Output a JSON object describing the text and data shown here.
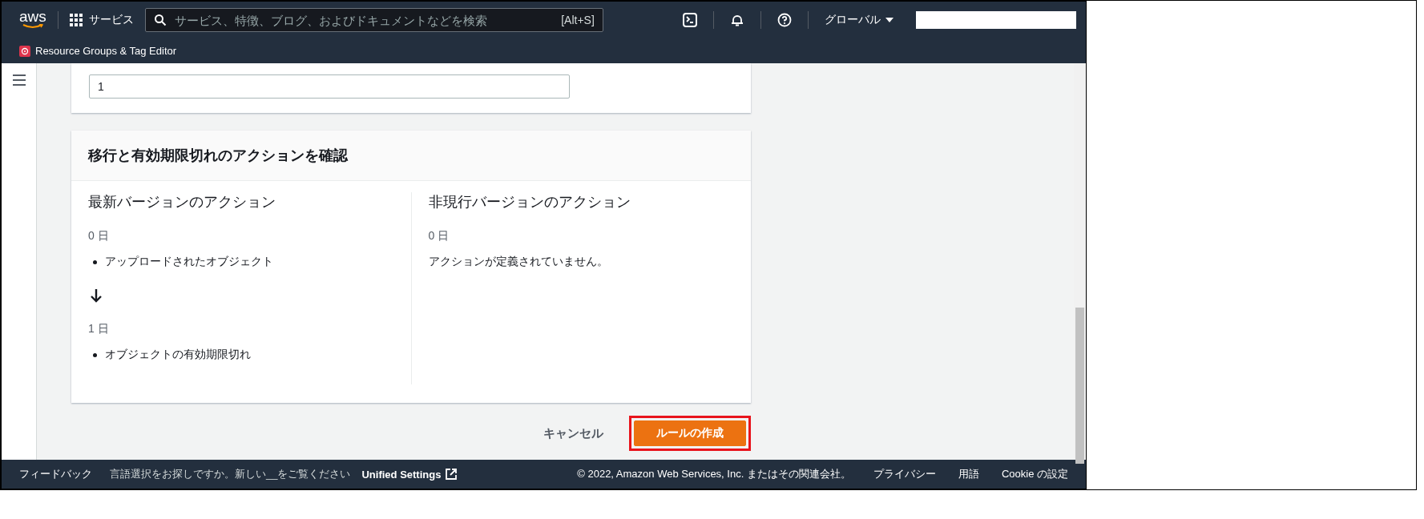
{
  "top_bar": {
    "logo": "aws",
    "services": "サービス",
    "search": {
      "placeholder": "サービス、特徴、ブログ、およびドキュメントなどを検索",
      "shortcut": "[Alt+S]"
    },
    "region": "グローバル"
  },
  "service_bar": {
    "label": "Resource Groups & Tag Editor"
  },
  "form_card": {
    "input_value": "1"
  },
  "review_card": {
    "title": "移行と有効期限切れのアクションを確認",
    "columns": [
      {
        "heading": "最新バージョンのアクション",
        "items": [
          {
            "kind": "day",
            "text": "0 日"
          },
          {
            "kind": "bullet",
            "text": "アップロードされたオブジェクト"
          },
          {
            "kind": "arrow"
          },
          {
            "kind": "day",
            "text": "1 日"
          },
          {
            "kind": "bullet",
            "text": "オブジェクトの有効期限切れ"
          }
        ]
      },
      {
        "heading": "非現行バージョンのアクション",
        "items": [
          {
            "kind": "day",
            "text": "0 日"
          },
          {
            "kind": "note",
            "text": "アクションが定義されていません。"
          }
        ]
      }
    ]
  },
  "actions": {
    "cancel": "キャンセル",
    "create": {
      "label": "ルールの作成",
      "highlighted": true
    }
  },
  "footer": {
    "feedback": "フィードバック",
    "language_prompt": "言語選択をお探しですか。新しい__をご覧ください",
    "unified_settings": "Unified Settings",
    "copyright": "© 2022, Amazon Web Services, Inc. またはその関連会社。",
    "links": [
      "プライバシー",
      "用語",
      "Cookie の設定"
    ]
  }
}
